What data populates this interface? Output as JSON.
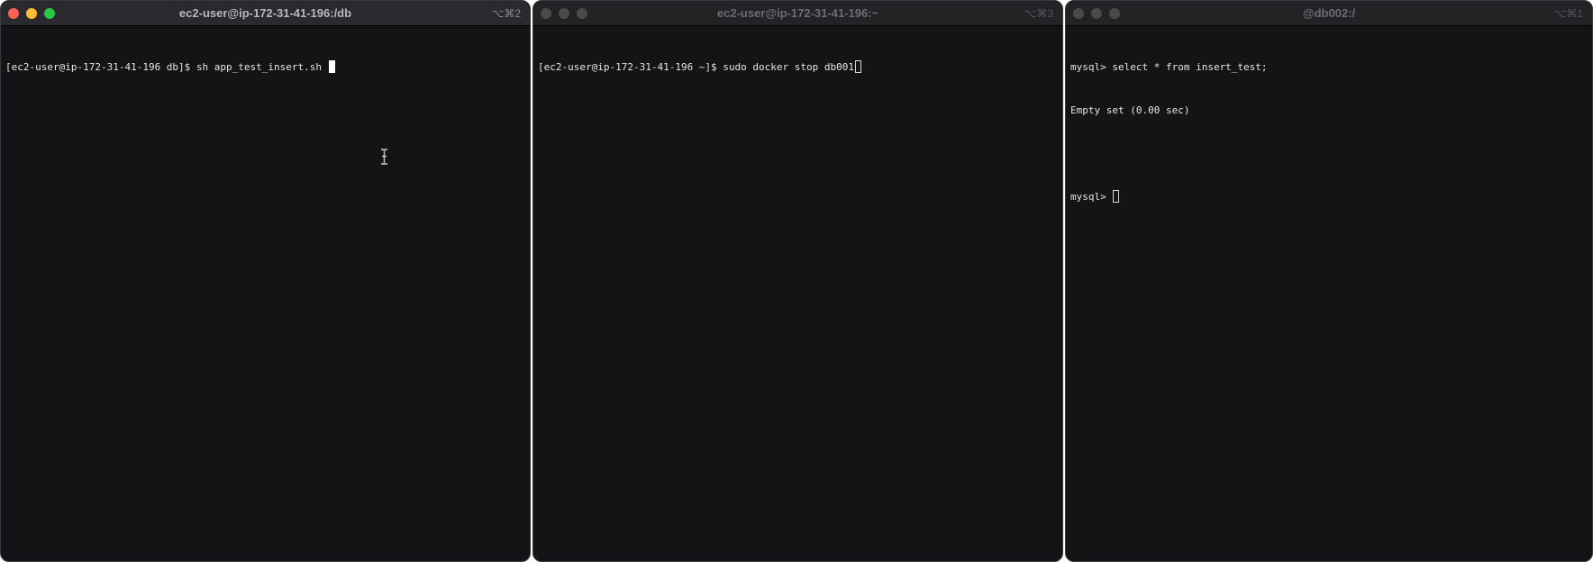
{
  "windows": [
    {
      "title": "ec2-user@ip-172-31-41-196:/db",
      "shortcut": "⌥⌘2",
      "lines": [
        "[ec2-user@ip-172-31-41-196 db]$ sh app_test_insert.sh "
      ]
    },
    {
      "title": "ec2-user@ip-172-31-41-196:~",
      "shortcut": "⌥⌘3",
      "lines": [
        "[ec2-user@ip-172-31-41-196 ~]$ sudo docker stop db001"
      ]
    },
    {
      "title": "@db002:/",
      "shortcut": "⌥⌘1",
      "lines": [
        "mysql> select * from insert_test;",
        "Empty set (0.00 sec)",
        "",
        "mysql> "
      ]
    }
  ],
  "colors": {
    "terminal_bg": "#141417",
    "text": "#e6e6e6",
    "close": "#fe5f57",
    "minimize": "#febc2e",
    "maximize": "#28c840"
  }
}
